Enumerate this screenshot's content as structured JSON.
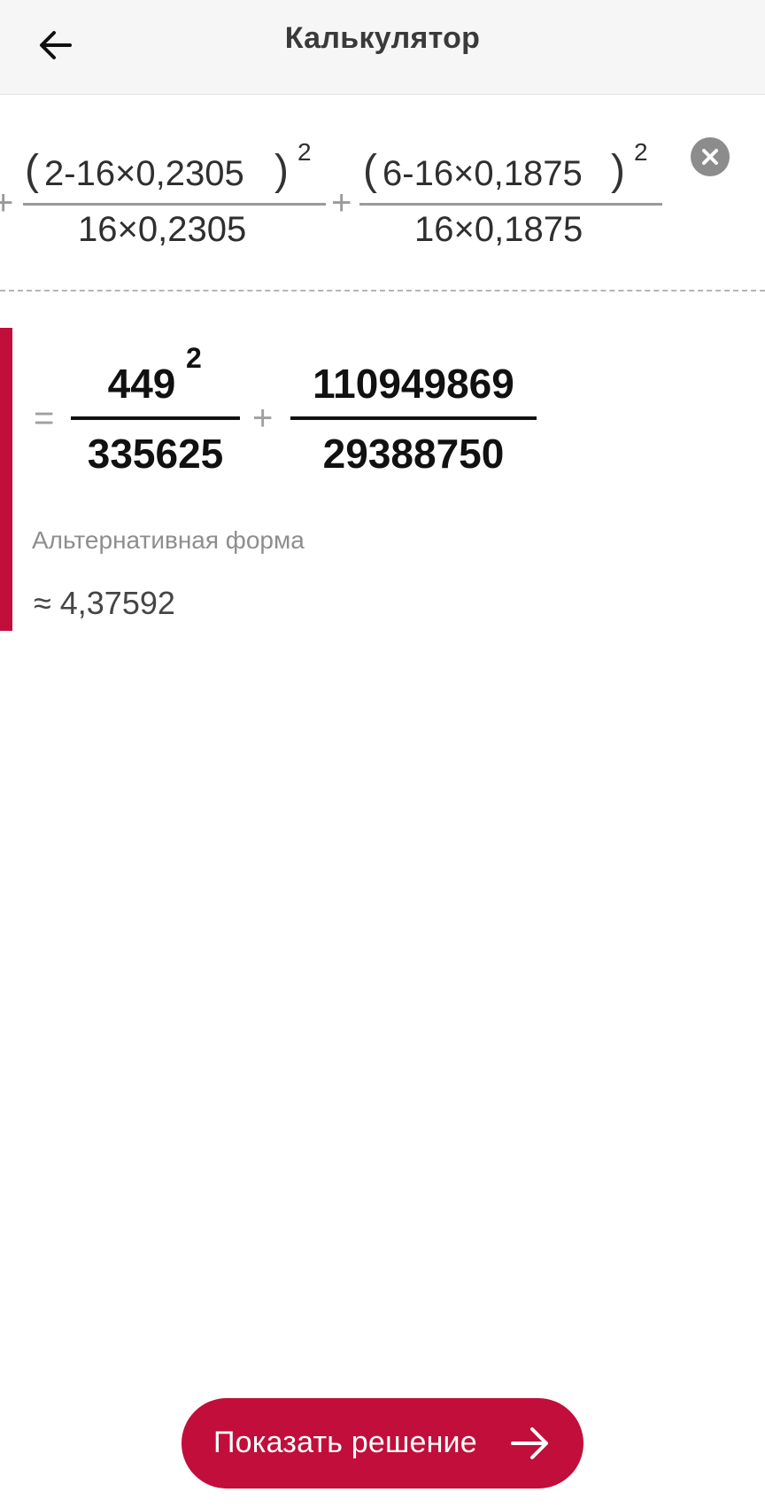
{
  "header": {
    "title": "Калькулятор",
    "back_icon": "arrow-left-icon"
  },
  "expression": {
    "leading_operator": "+",
    "term1": {
      "numerator_open": "(",
      "numerator": "2-16×0,2305",
      "numerator_close": ")",
      "exponent": "2",
      "denominator": "16×0,2305"
    },
    "between_operator": "+",
    "term2": {
      "numerator_open": "(",
      "numerator": "6-16×0,1875",
      "numerator_close": ")",
      "exponent": "2",
      "denominator": "16×0,1875"
    },
    "clear_icon": "close-circle-icon"
  },
  "result": {
    "equals": "=",
    "frac1": {
      "numerator": "449",
      "exponent": "2",
      "denominator": "335625"
    },
    "plus": "+",
    "frac2": {
      "numerator": "110949869",
      "denominator": "29388750"
    }
  },
  "alternative": {
    "label": "Альтернативная форма",
    "value": "≈ 4,37592"
  },
  "solve_button": {
    "label": "Показать решение",
    "icon": "arrow-right-icon"
  },
  "colors": {
    "accent": "#c10e3a",
    "appbar_bg": "#f6f6f6",
    "muted_text": "#8e8e8e"
  }
}
